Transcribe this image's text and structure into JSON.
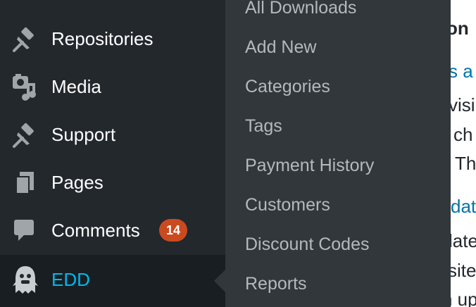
{
  "sidebar": {
    "items": [
      {
        "label": "Repositories",
        "icon": "pin-icon"
      },
      {
        "label": "Media",
        "icon": "media-icon"
      },
      {
        "label": "Support",
        "icon": "pin-icon"
      },
      {
        "label": "Pages",
        "icon": "pages-icon"
      },
      {
        "label": "Comments",
        "icon": "comment-icon",
        "badge": "14"
      },
      {
        "label": "EDD",
        "icon": "edd-ghost-icon",
        "active": true
      }
    ]
  },
  "submenu": {
    "items": [
      {
        "label": "All Downloads"
      },
      {
        "label": "Add New"
      },
      {
        "label": "Categories"
      },
      {
        "label": "Tags"
      },
      {
        "label": "Payment History"
      },
      {
        "label": "Customers"
      },
      {
        "label": "Discount Codes"
      },
      {
        "label": "Reports"
      }
    ]
  },
  "content": {
    "fragments": [
      "on",
      "s a",
      "visi",
      "ch",
      ". Th",
      "dat",
      "late",
      "site",
      "n up"
    ]
  },
  "colors": {
    "sidebar_bg": "#23282d",
    "submenu_bg": "#32373c",
    "active_bg": "#191e23",
    "active_text": "#00b9eb",
    "submenu_text": "#b4b9be",
    "badge_bg": "#ca4a1f",
    "link": "#0073aa"
  }
}
